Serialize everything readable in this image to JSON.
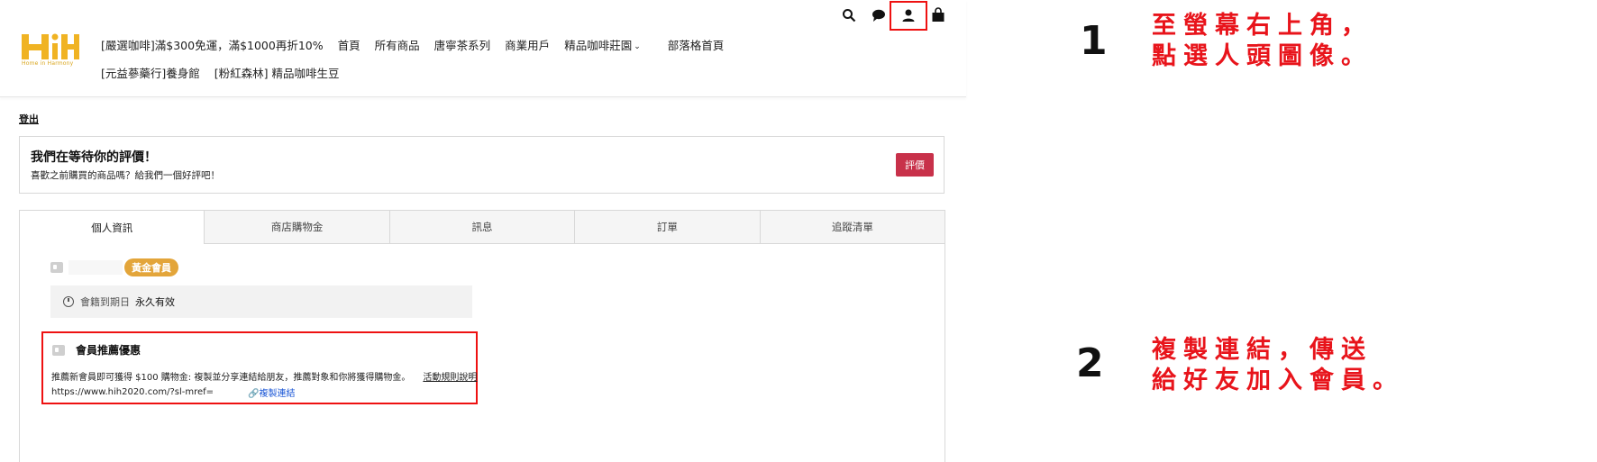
{
  "header": {
    "logo_text": "HiH",
    "logo_tagline": "Home in Harmony",
    "nav_row1": [
      "[嚴選咖啡]滿$300免運，滿$1000再折10%",
      "首頁",
      "所有商品",
      "唐寧茶系列",
      "商業用戶",
      "精品咖啡莊園",
      "部落格首頁"
    ],
    "nav_row2": [
      "[元益蔘藥行]養身館",
      "[粉紅森林] 精品咖啡生豆"
    ],
    "icons": [
      "search-icon",
      "chat-icon",
      "user-icon",
      "shopping-bag-icon"
    ]
  },
  "account": {
    "logout": "登出"
  },
  "review": {
    "title": "我們在等待你的評價！",
    "subtitle": "喜歡之前購買的商品嗎？給我們一個好評吧！",
    "button": "評價"
  },
  "tabs": [
    "個人資訊",
    "商店購物金",
    "訊息",
    "訂單",
    "追蹤清單"
  ],
  "member": {
    "tier": "黃金會員",
    "expiry_label": "會籍到期日",
    "expiry_value": "永久有效"
  },
  "referral": {
    "title": "會員推薦優惠",
    "description": "推薦新會員即可獲得 $100 購物金: 複製並分享連結給朋友，推薦對象和你將獲得購物金。",
    "rules_link": "活動規則說明",
    "url": "https://www.hih2020.com/?sl-mref=",
    "copy_link": "複製連結"
  },
  "instructions": {
    "step1_number": "1",
    "step1_line1": "至螢幕右上角，",
    "step1_line2": "點選人頭圖像。",
    "step2_number": "2",
    "step2_line1": "複製連結，傳送",
    "step2_line2": "給好友加入會員。"
  },
  "colors": {
    "accent_red": "#e8141b",
    "review_button": "#c8314a",
    "gold_badge": "#e3a53a",
    "logo_gold": "#f0b323",
    "link_blue": "#1a56d6"
  }
}
